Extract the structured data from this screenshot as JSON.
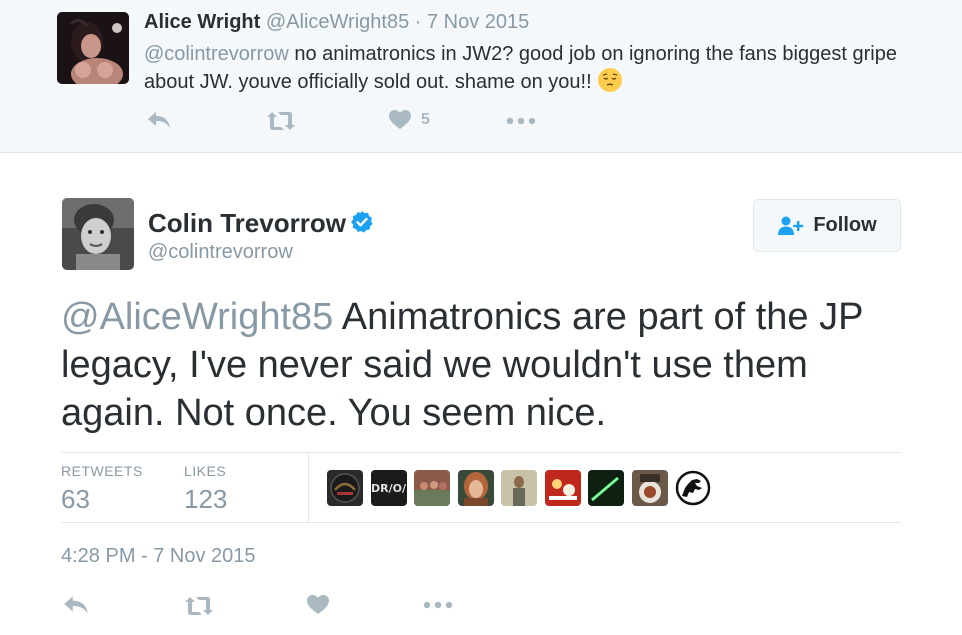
{
  "reply": {
    "name": "Alice Wright",
    "handle": "@AliceWright85",
    "dot": "·",
    "date": "7 Nov 2015",
    "mention": "@colintrevorrow",
    "text": " no animatronics in JW2? good job on ignoring the fans biggest gripe about JW. youve officially sold out. shame on you!!",
    "emoji": "pensive-face-icon",
    "likes_count": "5"
  },
  "tweet": {
    "name": "Colin Trevorrow",
    "handle": "@colintrevorrow",
    "verified": true,
    "follow_label": "Follow",
    "mention": "@AliceWright85",
    "text": " Animatronics are part of the JP legacy, I've never said we wouldn't use them again. Not once. You seem nice.",
    "retweets_label": "RETWEETS",
    "retweets_count": "63",
    "likes_label": "LIKES",
    "likes_count": "123",
    "timestamp": "4:28 PM - 7 Nov 2015",
    "liker_avatars": [
      {
        "label": "",
        "color": "#2a2a2a"
      },
      {
        "label": "DR/O/",
        "color": "#1b1b1b"
      },
      {
        "label": "",
        "color": "#8b5a4a"
      },
      {
        "label": "",
        "color": "#b5653a"
      },
      {
        "label": "",
        "color": "#a8a28a"
      },
      {
        "label": "",
        "color": "#c0281e"
      },
      {
        "label": "",
        "color": "#0f2a14"
      },
      {
        "label": "",
        "color": "#6b5a48"
      },
      {
        "label": "",
        "color": "#ffffff"
      }
    ]
  },
  "colors": {
    "text": "#292f33",
    "muted": "#8899a6",
    "action_icon": "#aab8c2",
    "verified_blue": "#1da1f2",
    "follow_icon_blue": "#1da1f2",
    "context_bg": "#f5f8fa",
    "border": "#e1e8ed"
  },
  "icons": {
    "reply": "reply-icon",
    "retweet": "retweet-icon",
    "like": "heart-icon",
    "more": "more-dots-icon",
    "follow": "add-user-icon",
    "verified": "verified-badge-icon"
  }
}
